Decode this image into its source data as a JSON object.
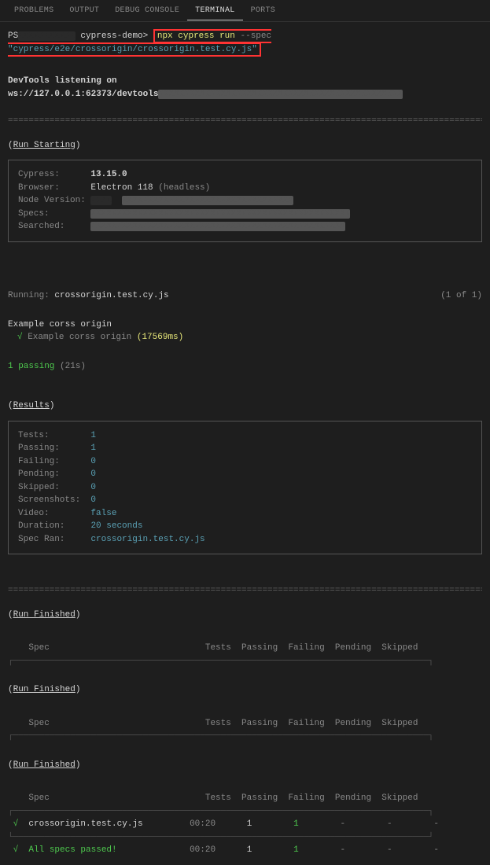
{
  "tabs": {
    "problems": "PROBLEMS",
    "output": "OUTPUT",
    "debug": "DEBUG CONSOLE",
    "terminal": "TERMINAL",
    "ports": "PORTS"
  },
  "prompt": {
    "prefix": "PS",
    "folder": " cypress-demo>",
    "cmd1": "npx cypress run",
    "cmd2": " --spec ",
    "cmd3": "\"cypress/e2e/crossorigin/crossorigin.test.cy.js\""
  },
  "devtools": "DevTools listening on ws://127.0.0.1:62373/devtools",
  "divider": "====================================================================================================",
  "run_starting": {
    "label": "Run Starting",
    "box": {
      "cypress_label": "Cypress:",
      "cypress_val": "13.15.0",
      "browser_label": "Browser:",
      "browser_val": "Electron 118 ",
      "browser_mode": "(headless)",
      "node_label": "Node Version:",
      "specs_label": "Specs:",
      "searched_label": "Searched:"
    }
  },
  "running": {
    "label": "Running:",
    "file": "crossorigin.test.cy.js",
    "count": "(1 of 1)"
  },
  "suite": {
    "title": "Example corss origin",
    "check": "√",
    "test": " Example corss origin ",
    "duration": "(17569ms)"
  },
  "passing_line": {
    "count": "1 passing",
    "time": " (21s)"
  },
  "results": {
    "label": "Results",
    "tests_label": "Tests:",
    "tests_val": "1",
    "passing_label": "Passing:",
    "passing_val": "1",
    "failing_label": "Failing:",
    "failing_val": "0",
    "pending_label": "Pending:",
    "pending_val": "0",
    "skipped_label": "Skipped:",
    "skipped_val": "0",
    "screenshots_label": "Screenshots:",
    "screenshots_val": "0",
    "video_label": "Video:",
    "video_val": "false",
    "duration_label": "Duration:",
    "duration_val": "20 seconds",
    "specran_label": "Spec Ran:",
    "specran_val": "crossorigin.test.cy.js"
  },
  "run_finished": "Run Finished",
  "summary": {
    "header": "    Spec                              Tests  Passing  Failing  Pending  Skipped",
    "line_top": "┌────────────────────────────────────────────────────────────────────────────────┐",
    "line_mid": "├────────────────────────────────────────────────────────────────────────────────┤",
    "line_bot": "└────────────────────────────────────────────────────────────────────────────────┘",
    "row_spec_check": "√",
    "row_spec_name": "  crossorigin.test.cy.js         ",
    "row_spec_time": "00:20",
    "row_spec_tests": "1",
    "row_spec_passing": "1",
    "row_spec_dash": "-",
    "row_all_check": "√",
    "row_all_text": "  All specs passed!              ",
    "row_all_time": "00:20",
    "row_all_tests": "1",
    "row_all_passing": "1"
  }
}
